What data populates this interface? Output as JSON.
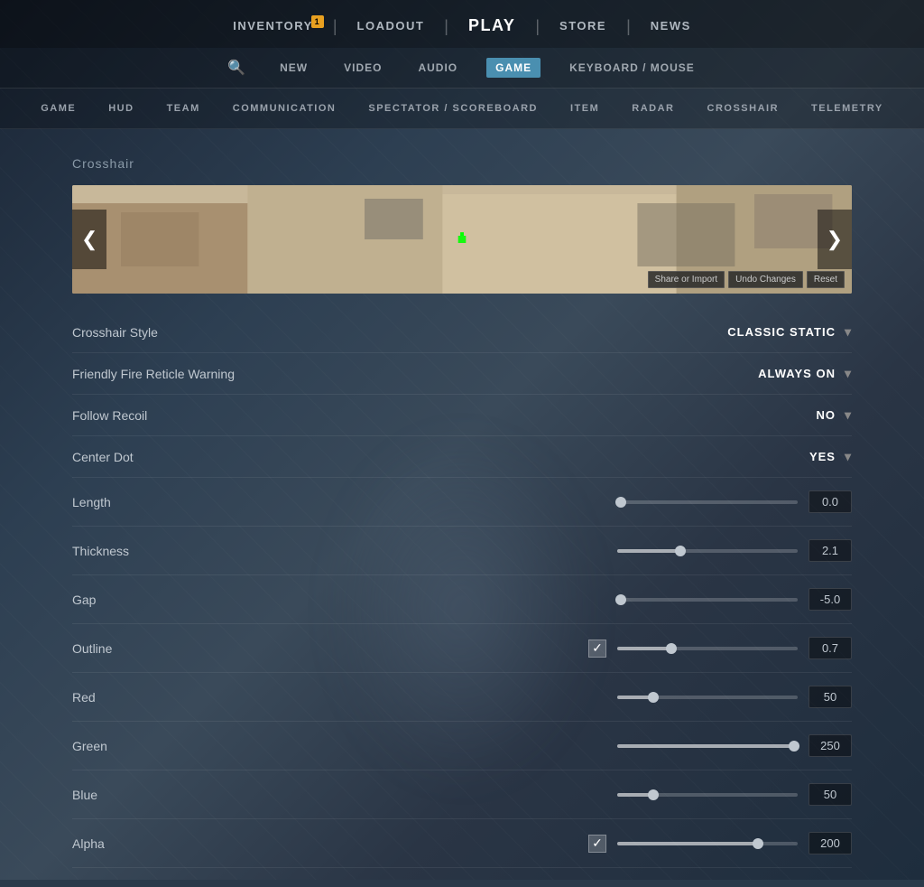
{
  "nav": {
    "items": [
      {
        "label": "INVENTORY",
        "active": false,
        "badge": "1"
      },
      {
        "label": "LOADOUT",
        "active": false,
        "badge": null
      },
      {
        "label": "PLAY",
        "active": true,
        "badge": null
      },
      {
        "label": "STORE",
        "active": false,
        "badge": null
      },
      {
        "label": "NEWS",
        "active": false,
        "badge": null
      }
    ]
  },
  "settings_tabs": {
    "search_placeholder": "Search",
    "items": [
      {
        "label": "NEW",
        "active": false
      },
      {
        "label": "VIDEO",
        "active": false
      },
      {
        "label": "AUDIO",
        "active": false
      },
      {
        "label": "GAME",
        "active": true
      },
      {
        "label": "KEYBOARD / MOUSE",
        "active": false
      }
    ]
  },
  "category_tabs": {
    "items": [
      {
        "label": "GAME"
      },
      {
        "label": "HUD"
      },
      {
        "label": "TEAM"
      },
      {
        "label": "COMMUNICATION"
      },
      {
        "label": "SPECTATOR / SCOREBOARD"
      },
      {
        "label": "ITEM"
      },
      {
        "label": "RADAR"
      },
      {
        "label": "CROSSHAIR"
      },
      {
        "label": "TELEMETRY"
      }
    ]
  },
  "section": {
    "title": "Crosshair",
    "preview": {
      "prev_btn": "❮",
      "next_btn": "❯",
      "action_btns": [
        "Share or Import",
        "Undo Changes",
        "Reset"
      ]
    },
    "rows": [
      {
        "id": "crosshair-style",
        "label": "Crosshair Style",
        "type": "dropdown",
        "value": "CLASSIC STATIC"
      },
      {
        "id": "friendly-fire",
        "label": "Friendly Fire Reticle Warning",
        "type": "dropdown",
        "value": "ALWAYS ON"
      },
      {
        "id": "follow-recoil",
        "label": "Follow Recoil",
        "type": "dropdown",
        "value": "NO"
      },
      {
        "id": "center-dot",
        "label": "Center Dot",
        "type": "dropdown",
        "value": "YES"
      },
      {
        "id": "length",
        "label": "Length",
        "type": "slider",
        "value": "0.0",
        "percent": 2
      },
      {
        "id": "thickness",
        "label": "Thickness",
        "type": "slider",
        "value": "2.1",
        "percent": 35
      },
      {
        "id": "gap",
        "label": "Gap",
        "type": "slider",
        "value": "-5.0",
        "percent": 2
      },
      {
        "id": "outline",
        "label": "Outline",
        "type": "slider-checkbox",
        "value": "0.7",
        "checked": true,
        "percent": 30
      },
      {
        "id": "red",
        "label": "Red",
        "type": "slider",
        "value": "50",
        "percent": 20
      },
      {
        "id": "green",
        "label": "Green",
        "type": "slider",
        "value": "250",
        "percent": 98
      },
      {
        "id": "blue",
        "label": "Blue",
        "type": "slider",
        "value": "50",
        "percent": 20
      },
      {
        "id": "alpha",
        "label": "Alpha",
        "type": "slider-checkbox",
        "value": "200",
        "checked": true,
        "percent": 78
      }
    ]
  },
  "icons": {
    "search": "🔍",
    "chevron_down": "▾",
    "check": "✓",
    "prev": "❮",
    "next": "❯"
  }
}
